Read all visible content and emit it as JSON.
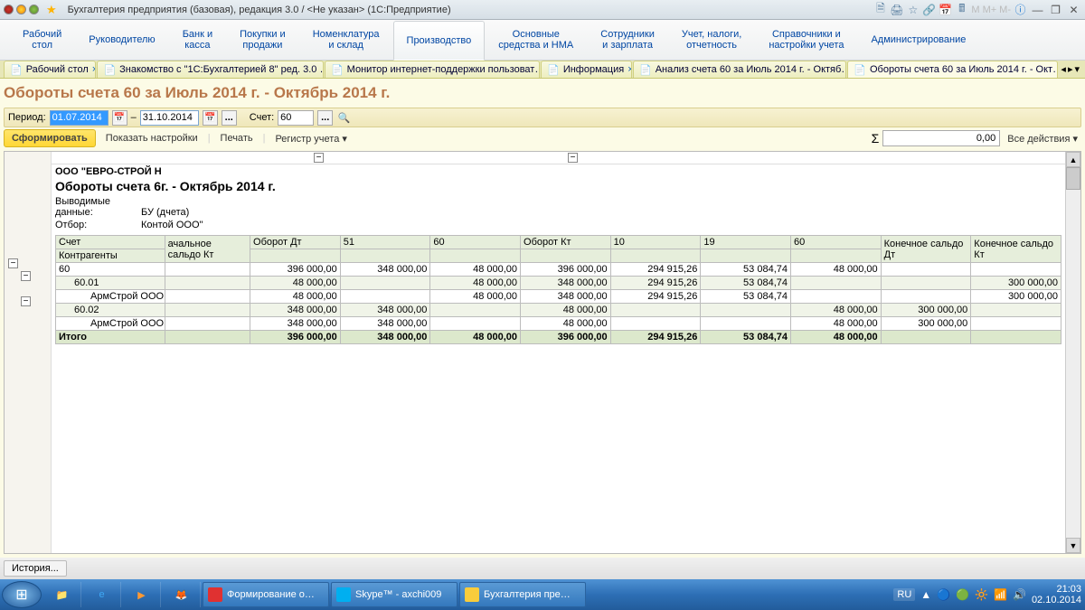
{
  "title": "Бухгалтерия предприятия (базовая), редакция 3.0 / <Не указан>  (1С:Предприятие)",
  "menu": [
    "Рабочий\nстол",
    "Руководителю",
    "Банк и\nкасса",
    "Покупки и\nпродажи",
    "Номенклатура\nи склад",
    "Производство",
    "Основные\nсредства и НМА",
    "Сотрудники\nи зарплата",
    "Учет, налоги,\nотчетность",
    "Справочники и\nнастройки учета",
    "Администрирование"
  ],
  "menu_active": 5,
  "tabs": [
    {
      "label": "Рабочий стол",
      "closable": true,
      "active": false
    },
    {
      "label": "Знакомство с \"1С:Бухгалтерией 8\" ред. 3.0 …",
      "closable": true,
      "active": false
    },
    {
      "label": "Монитор интернет-поддержки пользоват…",
      "closable": true,
      "active": false
    },
    {
      "label": "Информация",
      "closable": true,
      "active": false
    },
    {
      "label": "Анализ счета 60 за Июль 2014 г. - Октяб…",
      "closable": true,
      "active": false
    },
    {
      "label": "Обороты счета 60 за Июль 2014 г. - Окт…",
      "closable": true,
      "active": true
    }
  ],
  "page_heading": "Обороты счета 60 за Июль 2014 г. - Октябрь 2014 г.",
  "period": {
    "label": "Период:",
    "from": "01.07.2014",
    "to": "31.10.2014",
    "acct_label": "Счет:",
    "acct": "60"
  },
  "actions": {
    "form": "Сформировать",
    "settings": "Показать настройки",
    "print": "Печать",
    "register": "Регистр учета",
    "sum": "0,00",
    "all": "Все действия"
  },
  "report": {
    "org": "ООО \"ЕВРО-СТРОЙ Н",
    "title": "Обороты счета 6г. - Октябрь 2014 г.",
    "datatype_lbl": "Выводимые данные:",
    "datatype": "БУ (дчета)",
    "filter_lbl": "Отбор:",
    "filter": "Контой ООО\"",
    "headers": {
      "acct": "Счет",
      "kontr": "Контрагенты",
      "begkt": "ачальное\nсальдо Кт",
      "obdt": "Оборот Дт",
      "c51": "51",
      "c60a": "60",
      "obkt": "Оборот Кт",
      "c10": "10",
      "c19": "19",
      "c60b": "60",
      "enddt": "Конечное сальдо Дт",
      "endkt": "Конечное сальдо Кт"
    },
    "rows": [
      {
        "lv": 0,
        "acc": "60",
        "obdt": "396 000,00",
        "c51": "348 000,00",
        "c60a": "48 000,00",
        "obkt": "396 000,00",
        "c10": "294 915,26",
        "c19": "53 084,74",
        "c60b": "48 000,00",
        "enddt": "",
        "endkt": ""
      },
      {
        "lv": 1,
        "acc": "60.01",
        "obdt": "48 000,00",
        "c51": "",
        "c60a": "48 000,00",
        "obkt": "348 000,00",
        "c10": "294 915,26",
        "c19": "53 084,74",
        "c60b": "",
        "enddt": "",
        "endkt": "300 000,00"
      },
      {
        "lv": 2,
        "acc": "АрмСтрой ООО",
        "obdt": "48 000,00",
        "c51": "",
        "c60a": "48 000,00",
        "obkt": "348 000,00",
        "c10": "294 915,26",
        "c19": "53 084,74",
        "c60b": "",
        "enddt": "",
        "endkt": "300 000,00"
      },
      {
        "lv": 1,
        "acc": "60.02",
        "obdt": "348 000,00",
        "c51": "348 000,00",
        "c60a": "",
        "obkt": "48 000,00",
        "c10": "",
        "c19": "",
        "c60b": "48 000,00",
        "enddt": "300 000,00",
        "endkt": ""
      },
      {
        "lv": 2,
        "acc": "АрмСтрой ООО",
        "obdt": "348 000,00",
        "c51": "348 000,00",
        "c60a": "",
        "obkt": "48 000,00",
        "c10": "",
        "c19": "",
        "c60b": "48 000,00",
        "enddt": "300 000,00",
        "endkt": ""
      }
    ],
    "total": {
      "label": "Итого",
      "obdt": "396 000,00",
      "c51": "348 000,00",
      "c60a": "48 000,00",
      "obkt": "396 000,00",
      "c10": "294 915,26",
      "c19": "53 084,74",
      "c60b": "48 000,00",
      "enddt": "",
      "endkt": ""
    }
  },
  "history": "История...",
  "taskbar": {
    "apps": [
      {
        "label": "Формирование о…",
        "color": "#e03131"
      },
      {
        "label": "Skype™ - axchi009",
        "color": "#00aff0"
      },
      {
        "label": "Бухгалтерия пре…",
        "color": "#f9cc3c"
      }
    ],
    "lang": "RU",
    "time": "21:03",
    "date": "02.10.2014"
  }
}
